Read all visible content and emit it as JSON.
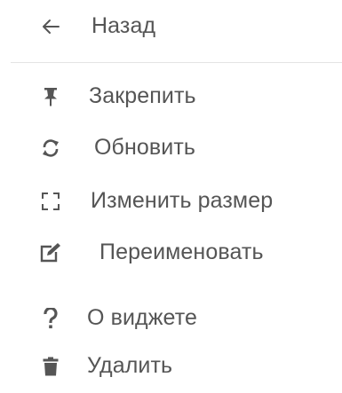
{
  "menu": {
    "back": {
      "label": "Назад",
      "icon": "arrow-left-icon"
    },
    "items": [
      {
        "label": "Закрепить",
        "icon": "pin-icon"
      },
      {
        "label": "Обновить",
        "icon": "refresh-icon"
      },
      {
        "label": "Изменить размер",
        "icon": "resize-icon"
      },
      {
        "label": "Переименовать",
        "icon": "edit-icon"
      },
      {
        "label": "О виджете",
        "icon": "question-icon"
      },
      {
        "label": "Удалить",
        "icon": "trash-icon"
      }
    ]
  },
  "colors": {
    "text": "#555555",
    "divider": "#e4e4e4",
    "background": "#ffffff"
  }
}
